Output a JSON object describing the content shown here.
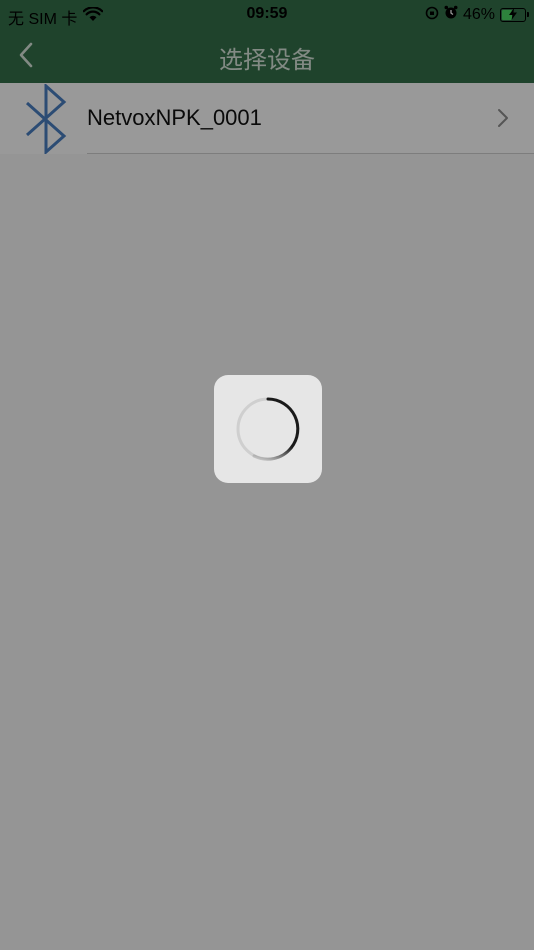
{
  "status_bar": {
    "carrier": "无 SIM 卡",
    "time": "09:59",
    "battery_percent": "46%",
    "battery_level": 0.46,
    "icons": [
      "wifi-icon",
      "orientation-lock-icon",
      "alarm-icon",
      "battery-charging-icon"
    ]
  },
  "nav": {
    "title": "选择设备",
    "back_icon": "chevron-left-icon"
  },
  "devices": [
    {
      "name": "NetvoxNPK_0001",
      "icon": "bluetooth-icon",
      "action_icon": "chevron-right-icon"
    }
  ],
  "loading": {
    "visible": true,
    "icon": "spinner-icon"
  },
  "colors": {
    "nav_bg": "#35714a",
    "bluetooth": "#4a7fc1",
    "overlay": "rgba(0,0,0,0.40)"
  }
}
